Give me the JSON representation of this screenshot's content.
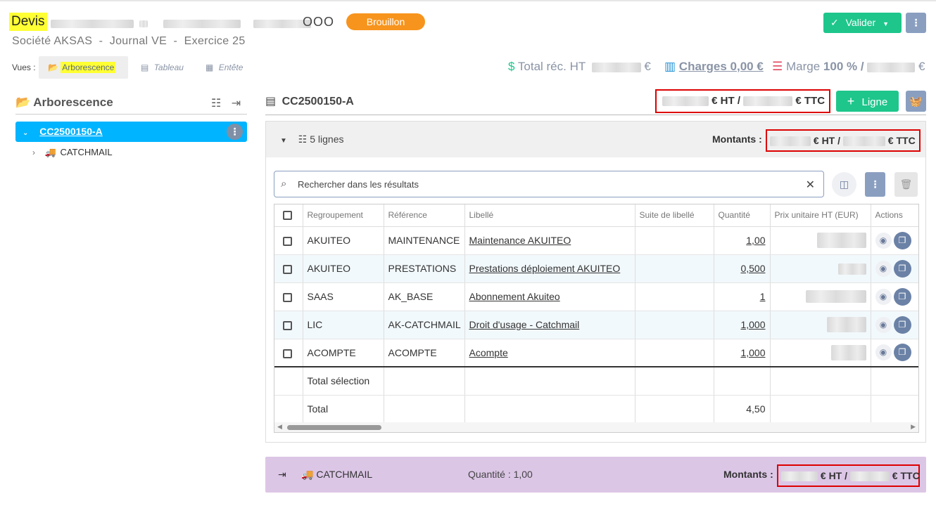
{
  "header": {
    "doc_type": "Devis",
    "circles": "OOO",
    "status": "Brouillon",
    "subtitle": "Société AKSAS  -  Journal VE  -  Exercice 25",
    "validate_label": "Valider",
    "more_label": "⋮"
  },
  "views": {
    "label": "Vues :",
    "tabs": [
      {
        "label": "Arborescence",
        "active": true
      },
      {
        "label": "Tableau",
        "active": false
      },
      {
        "label": "Entête",
        "active": false
      }
    ]
  },
  "kpis": {
    "total_label": "Total réc. HT",
    "total_unit": "€",
    "charges_label": "Charges 0,00 €",
    "margin_label": "Marge",
    "margin_value": "100 % /",
    "margin_unit": "€"
  },
  "tree": {
    "title": "Arborescence",
    "root": "CC2500150-A",
    "child": "CATCHMAIL"
  },
  "panel": {
    "title": "CC2500150-A",
    "totals_ht": "€ HT /",
    "totals_ttc": "€ TTC",
    "add_line_label": "Ligne",
    "lines_count": "5 lignes",
    "amounts_label": "Montants :"
  },
  "search": {
    "placeholder": "Rechercher dans les résultats"
  },
  "table": {
    "headers": [
      "Regroupement",
      "Référence",
      "Libellé",
      "Suite de libellé",
      "Quantité",
      "Prix unitaire HT (EUR)",
      "Actions"
    ],
    "rows": [
      {
        "group": "AKUITEO",
        "ref": "MAINTENANCE",
        "label": "Maintenance AKUITEO",
        "suite": "",
        "qty": "1,00"
      },
      {
        "group": "AKUITEO",
        "ref": "PRESTATIONS",
        "label": "Prestations déploiement AKUITEO",
        "suite": "",
        "qty": "0,500"
      },
      {
        "group": "SAAS",
        "ref": "AK_BASE",
        "label": "Abonnement Akuiteo",
        "suite": "",
        "qty": "1"
      },
      {
        "group": "LIC",
        "ref": "AK-CATCHMAIL",
        "label": "Droit d'usage - Catchmail",
        "suite": "",
        "qty": "1,000"
      },
      {
        "group": "ACOMPTE",
        "ref": "ACOMPTE",
        "label": "Acompte",
        "suite": "",
        "qty": "1,000"
      }
    ],
    "selection_label": "Total sélection",
    "total_label": "Total",
    "total_qty": "4,50"
  },
  "sub_block": {
    "name": "CATCHMAIL",
    "qty": "Quantité : 1,00",
    "amounts_label": "Montants :",
    "ht": "€ HT /",
    "ttc": "€ TTC"
  },
  "colors": {
    "accent_green": "#1ec68c",
    "status_orange": "#f7941d",
    "tree_active": "#00b4ff",
    "highlight": "#ffff33",
    "sub_block": "#dcc6e6"
  }
}
